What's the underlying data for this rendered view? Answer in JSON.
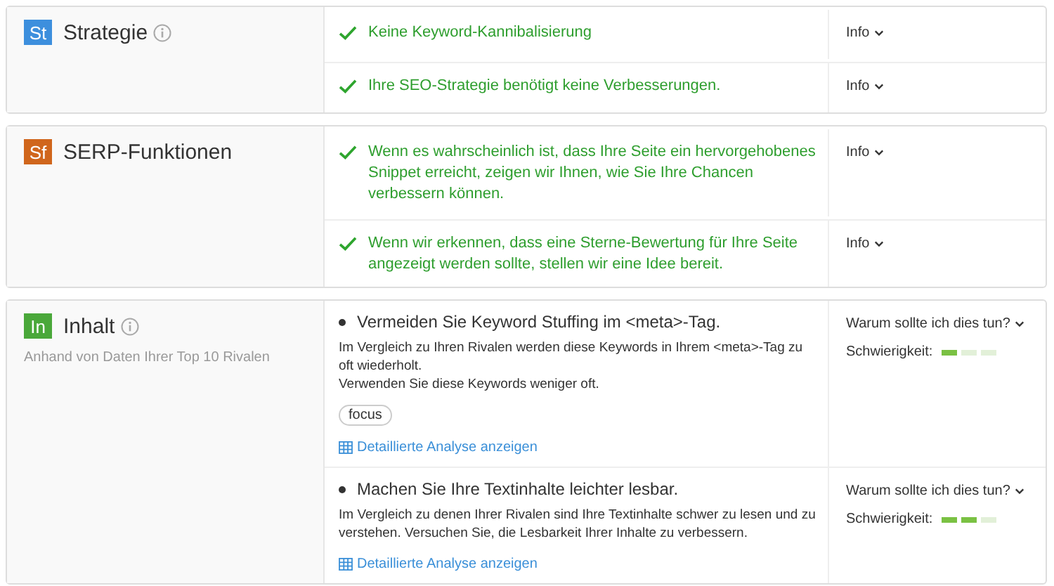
{
  "sections": [
    {
      "badge": "St",
      "color": "#3d8fdd",
      "title": "Strategie",
      "info_icon": true,
      "items": [
        {
          "kind": "check",
          "text": "Keine Keyword-Kannibalisierung",
          "action": "Info"
        },
        {
          "kind": "check",
          "text": "Ihre SEO-Strategie benötigt keine Verbesserungen.",
          "action": "Info"
        }
      ]
    },
    {
      "badge": "Sf",
      "color": "#d0661c",
      "title": "SERP-Funktionen",
      "info_icon": false,
      "items": [
        {
          "kind": "check",
          "text": "Wenn es wahrscheinlich ist, dass Ihre Seite ein hervorgehobenes Snippet erreicht, zeigen wir Ihnen, wie Sie Ihre Chancen verbessern können.",
          "action": "Info"
        },
        {
          "kind": "check",
          "text": "Wenn wir erkennen, dass eine Sterne-Bewertung für Ihre Seite angezeigt werden sollte, stellen wir eine Idee bereit.",
          "action": "Info"
        }
      ]
    },
    {
      "badge": "In",
      "color": "#4aa83a",
      "title": "Inhalt",
      "info_icon": true,
      "subtitle": "Anhand von Daten Ihrer Top 10 Rivalen",
      "items": [
        {
          "kind": "tip",
          "text": "Vermeiden Sie Keyword Stuffing im <meta>-Tag.",
          "description": [
            "Im Vergleich zu Ihren Rivalen werden diese Keywords in Ihrem <meta>-Tag zu oft wiederholt.",
            "Verwenden Sie diese Keywords weniger oft."
          ],
          "tags": [
            "focus"
          ],
          "link": "Detaillierte Analyse anzeigen",
          "action": "Warum sollte ich dies tun?",
          "difficulty_label": "Schwierigkeit:",
          "level": 0.33
        },
        {
          "kind": "tip",
          "text": "Machen Sie Ihre Textinhalte leichter lesbar.",
          "description": [
            "Im Vergleich zu denen Ihrer Rivalen sind Ihre Textinhalte schwer zu lesen und zu verstehen. Versuchen Sie, die Lesbarkeit Ihrer Inhalte zu verbessern."
          ],
          "link": "Detaillierte Analyse anzeigen",
          "action": "Warum sollte ich dies tun?",
          "difficulty_label": "Schwierigkeit:",
          "level": 0.67
        }
      ]
    }
  ]
}
